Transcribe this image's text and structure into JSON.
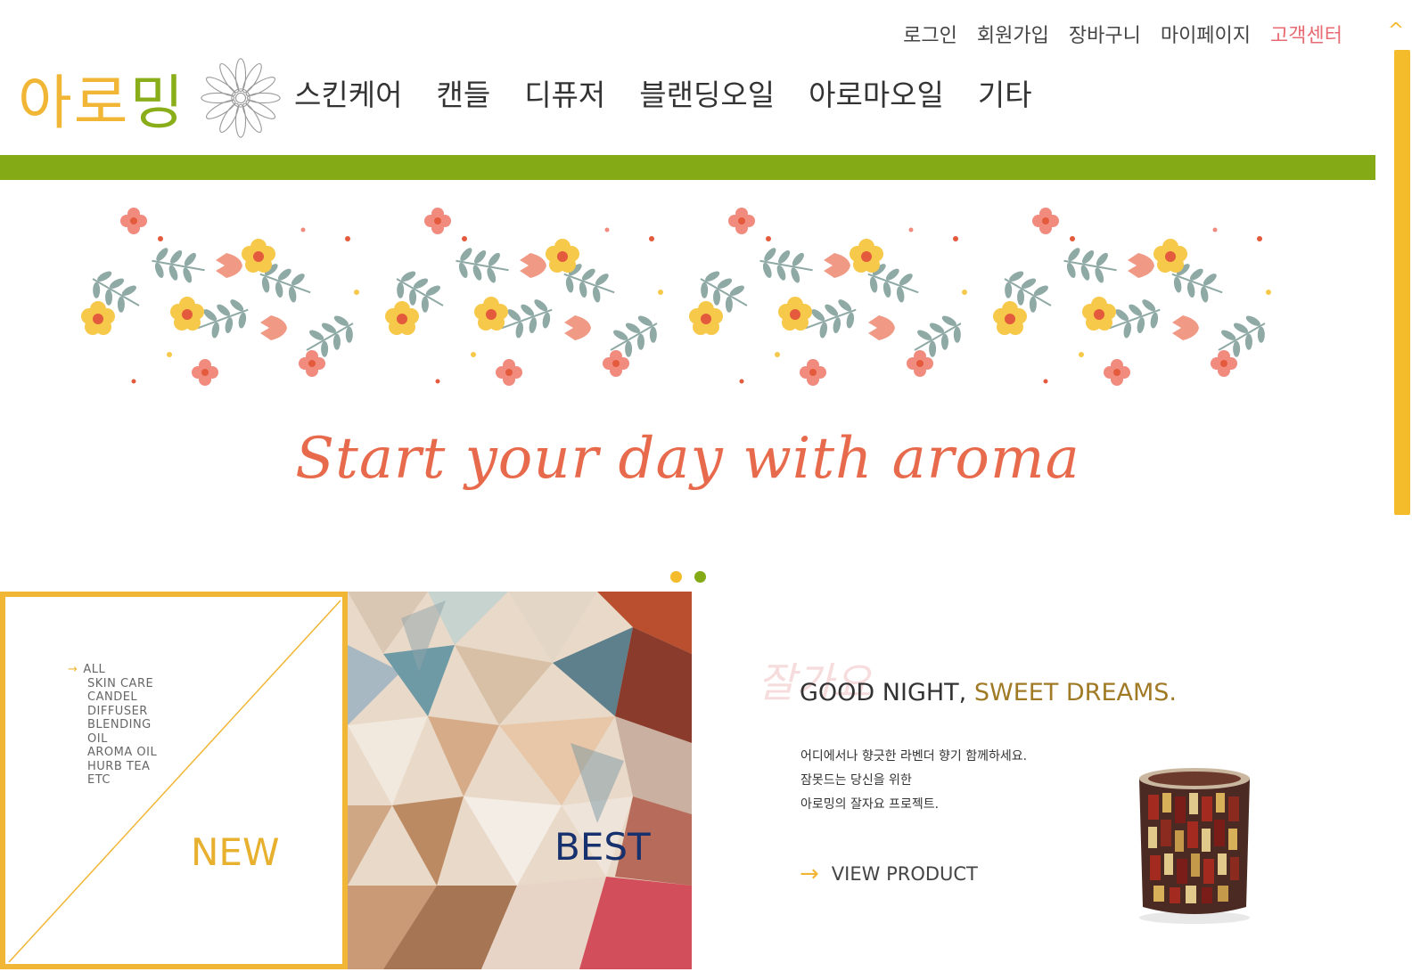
{
  "util_nav": {
    "login": "로그인",
    "signup": "회원가입",
    "cart": "장바구니",
    "mypage": "마이페이지",
    "support": "고객센터"
  },
  "logo": {
    "part1": "아로",
    "part2": "밍"
  },
  "main_nav": [
    "스킨케어",
    "캔들",
    "디퓨저",
    "블랜딩오일",
    "아로마오일",
    "기타"
  ],
  "banner": {
    "tagline": "Start your day with aroma"
  },
  "categories": [
    "ALL",
    "SKIN CARE",
    "CANDEL",
    "DIFFUSER",
    "BLENDING",
    "OIL",
    "AROMA OIL",
    "HURB TEA",
    "ETC"
  ],
  "panels": {
    "new": "NEW",
    "best": "BEST"
  },
  "promo": {
    "watermark": "잘가요",
    "title_plain": "GOOD NIGHT,",
    "title_accent": "SWEET DREAMS.",
    "lines": [
      "어디에서나 향긋한 라벤더 향기 함께하세요.",
      "잠못드는 당신을 위한",
      "아로밍의 잘자요 프로젝트."
    ],
    "cta": "VIEW PRODUCT"
  },
  "colors": {
    "brand_yellow": "#f1b635",
    "brand_green": "#84ab16",
    "accent_coral": "#e86a4c",
    "navy": "#16316d"
  }
}
